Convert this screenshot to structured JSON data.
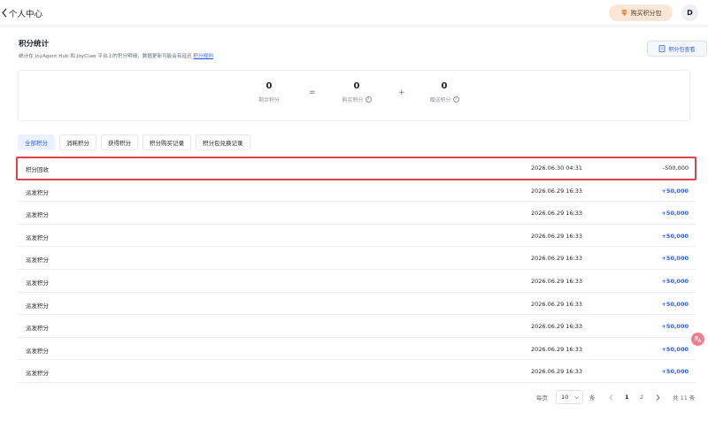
{
  "header": {
    "title": "个人中心",
    "buy_button": "购买积分包",
    "avatar_initial": "D"
  },
  "stats": {
    "title": "积分统计",
    "description": "统计在 JoyAgent Hub 和 JoyClaw 平台上的积分明细，数据更新可能会有延迟",
    "rule_link": "积分规则",
    "detail_button": "积分包查看"
  },
  "summary": {
    "remaining": {
      "value": "0",
      "label": "剩余积分"
    },
    "equals": "=",
    "purchased": {
      "value": "0",
      "label": "购买积分"
    },
    "plus": "+",
    "gifted": {
      "value": "0",
      "label": "赠送积分"
    }
  },
  "tabs": [
    {
      "label": "全部积分",
      "active": true
    },
    {
      "label": "消耗积分",
      "active": false
    },
    {
      "label": "获得积分",
      "active": false
    },
    {
      "label": "积分购买记录",
      "active": false
    },
    {
      "label": "积分包兑换记录",
      "active": false
    }
  ],
  "records": [
    {
      "name": "积分回收",
      "time": "2026.06.30 04:31",
      "amount": "-500,000",
      "sign": "neg"
    },
    {
      "name": "派发积分",
      "time": "2026.06.29 16:33",
      "amount": "+50,000",
      "sign": "pos"
    },
    {
      "name": "派发积分",
      "time": "2026.06.29 16:33",
      "amount": "+50,000",
      "sign": "pos"
    },
    {
      "name": "派发积分",
      "time": "2026.06.29 16:33",
      "amount": "+50,000",
      "sign": "pos"
    },
    {
      "name": "派发积分",
      "time": "2026.06.29 16:33",
      "amount": "+50,000",
      "sign": "pos"
    },
    {
      "name": "派发积分",
      "time": "2026.06.29 16:33",
      "amount": "+50,000",
      "sign": "pos"
    },
    {
      "name": "派发积分",
      "time": "2026.06.29 16:33",
      "amount": "+50,000",
      "sign": "pos"
    },
    {
      "name": "派发积分",
      "time": "2026.06.29 16:33",
      "amount": "+50,000",
      "sign": "pos"
    },
    {
      "name": "派发积分",
      "time": "2026.06.29 16:33",
      "amount": "+50,000",
      "sign": "pos"
    },
    {
      "name": "派发积分",
      "time": "2026.06.29 16:33",
      "amount": "+50,000",
      "sign": "pos"
    }
  ],
  "pagination": {
    "per_page_label": "每页",
    "page_size": "10",
    "unit": "条",
    "pages": [
      "1",
      "2"
    ],
    "current_page": "1",
    "total": "共 11 条"
  },
  "float_button_icon": "translate-icon"
}
